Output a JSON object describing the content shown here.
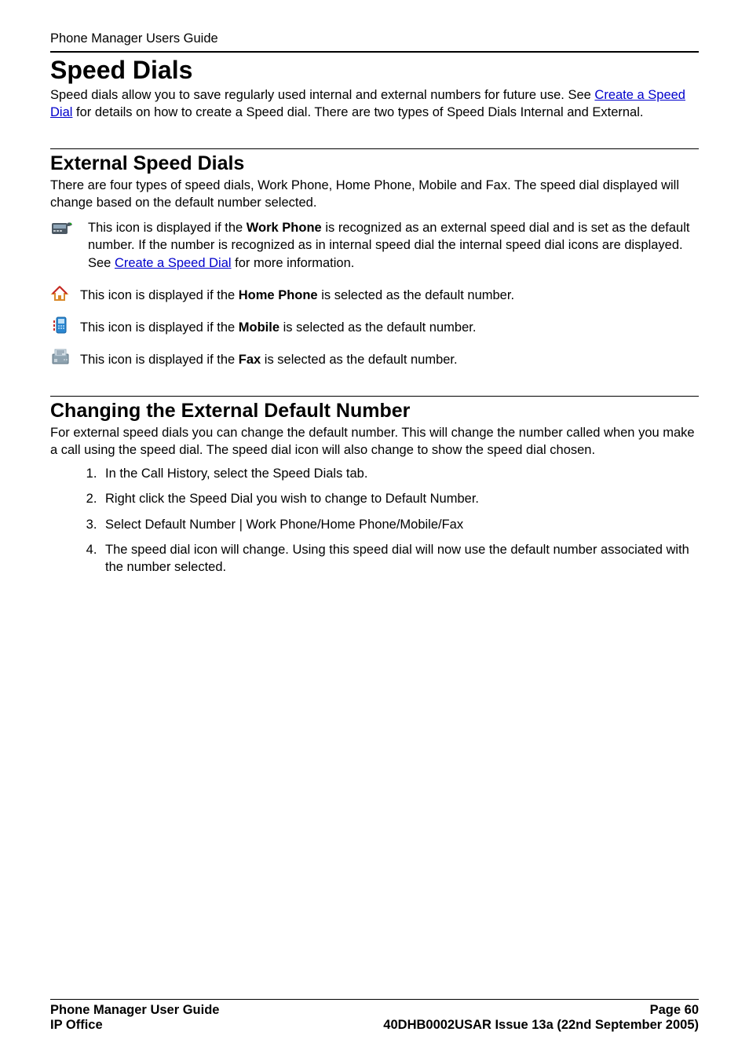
{
  "header": {
    "running_title": "Phone Manager Users Guide"
  },
  "section1": {
    "title": "Speed Dials",
    "intro_pre": "Speed dials allow you to save regularly used internal and external numbers for future use. See ",
    "intro_link": "Create a Speed Dial",
    "intro_post": " for details on how to create a Speed dial. There are two types of Speed Dials Internal and External."
  },
  "section2": {
    "title": "External Speed Dials",
    "intro": "There are four types of speed dials, Work Phone, Home Phone, Mobile and Fax. The speed dial displayed will change based on the default number selected.",
    "work": {
      "pre": "This icon is displayed if the ",
      "bold": "Work Phone",
      "mid": " is recognized as an external speed dial and is set as the default number. If the number is recognized as in internal speed dial the internal speed dial icons are displayed. See ",
      "link": "Create a Speed Dial",
      "post": " for more information."
    },
    "home": {
      "pre": "This icon is displayed if the ",
      "bold": "Home Phone",
      "post": " is selected as the default number."
    },
    "mobile": {
      "pre": "This icon is displayed if the ",
      "bold": "Mobile",
      "post": " is selected as the default number."
    },
    "fax": {
      "pre": "This icon is displayed if the ",
      "bold": "Fax",
      "post": " is selected as the default number."
    }
  },
  "section3": {
    "title": "Changing the External Default Number",
    "intro": "For external speed dials you can change the default number. This will change the number called when you make a call using the speed dial. The speed dial icon will also change to show the speed dial chosen.",
    "steps": [
      "In the Call History, select the Speed Dials tab.",
      "Right click the Speed Dial you wish to change to Default Number.",
      "Select Default Number | Work Phone/Home Phone/Mobile/Fax",
      "The speed dial icon will change. Using this speed dial will now use the default number associated with the number selected."
    ]
  },
  "footer": {
    "left1": "Phone Manager User Guide",
    "right1": "Page 60",
    "left2": "IP Office",
    "right2": "40DHB0002USAR Issue 13a (22nd September 2005)"
  }
}
